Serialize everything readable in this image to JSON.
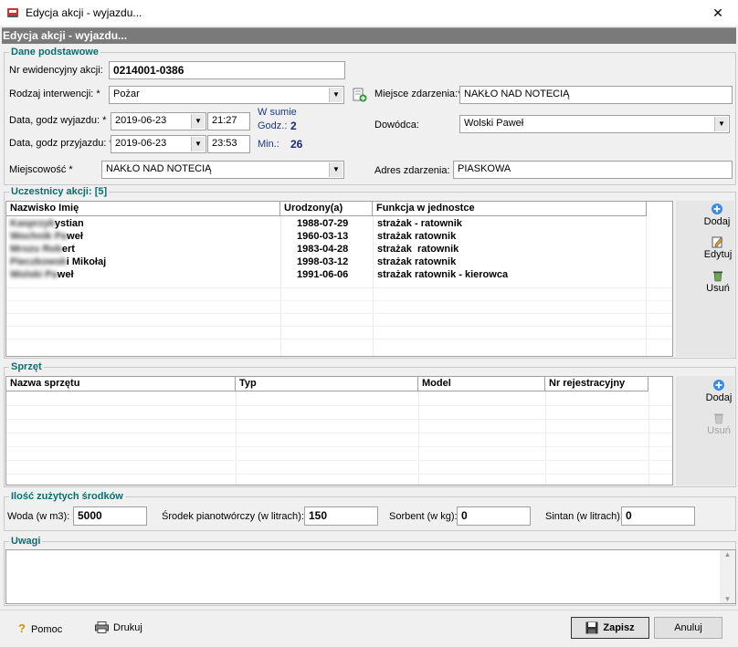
{
  "window": {
    "title": "Edycja akcji - wyjazdu...",
    "close_glyph": "✕"
  },
  "header": {
    "title": "Edycja akcji - wyjazdu..."
  },
  "basic": {
    "legend": "Dane podstawowe",
    "nr_label": "Nr ewidencyjny akcji:",
    "nr_value": "0214001-0386",
    "rodzaj_label": "Rodzaj interwencji: *",
    "rodzaj_value": "Pożar",
    "miejsce_label": "Miejsce zdarzenia:*",
    "miejsce_value": "NAKŁO NAD NOTECIĄ",
    "wyjazd_label": "Data, godz wyjazdu: *",
    "wyjazd_date": "2019-06-23",
    "wyjazd_time": "21:27",
    "przyjazd_label": "Data, godz przyjazdu: *",
    "przyjazd_date": "2019-06-23",
    "przyjazd_time": "23:53",
    "sum_label": "W sumie",
    "godz_label": "Godz.:",
    "godz_value": "2",
    "min_label": "Min.:",
    "min_value": "26",
    "dowodca_label": "Dowódca:",
    "dowodca_value": "Wolski Paweł",
    "miejscowosc_label": "Miejscowość *",
    "miejscowosc_value": "NAKŁO NAD NOTECIĄ",
    "adres_label": "Adres zdarzenia:",
    "adres_value": "PIASKOWA"
  },
  "participants": {
    "legend": "Uczestnicy akcji: [5]",
    "columns": [
      "Nazwisko Imię",
      "Urodzony(a)",
      "Funkcja w jednostce"
    ],
    "rows": [
      {
        "name_hidden": "Kasprzyk",
        "name_visible": "ystian",
        "born": "1988-07-29",
        "func": "strażak - ratownik"
      },
      {
        "name_hidden": "Wochnik Pa",
        "name_visible": "weł",
        "born": "1960-03-13",
        "func": "strażak ratownik"
      },
      {
        "name_hidden": "Mrozu Rob",
        "name_visible": "ert",
        "born": "1983-04-28",
        "func": "strażak  ratownik"
      },
      {
        "name_hidden": "Pieczkowsk",
        "name_visible": "i Mikołaj",
        "born": "1998-03-12",
        "func": "strażak ratownik"
      },
      {
        "name_hidden": "Wolski Pa",
        "name_visible": "weł",
        "born": "1991-06-06",
        "func": "strażak ratownik - kierowca"
      }
    ],
    "add": "Dodaj",
    "edit": "Edytuj",
    "remove": "Usuń"
  },
  "equipment": {
    "legend": "Sprzęt",
    "columns": [
      "Nazwa sprzętu",
      "Typ",
      "Model",
      "Nr rejestracyjny"
    ],
    "add": "Dodaj",
    "remove": "Usuń"
  },
  "resources": {
    "legend": "Ilość zużytych środków",
    "woda_label": "Woda (w m3):",
    "woda_value": "5000",
    "srodek_label": "Środek pianotwórczy (w litrach):",
    "srodek_value": "150",
    "sorbent_label": "Sorbent (w kg):",
    "sorbent_value": "0",
    "sintan_label": "Sintan (w litrach):",
    "sintan_value": "0"
  },
  "notes": {
    "legend": "Uwagi",
    "value": ""
  },
  "footer": {
    "help": "Pomoc",
    "print": "Drukuj",
    "save": "Zapisz",
    "cancel": "Anuluj"
  },
  "colors": {
    "accent": "#0a6e6e",
    "header_bg": "#7a7a7a"
  }
}
